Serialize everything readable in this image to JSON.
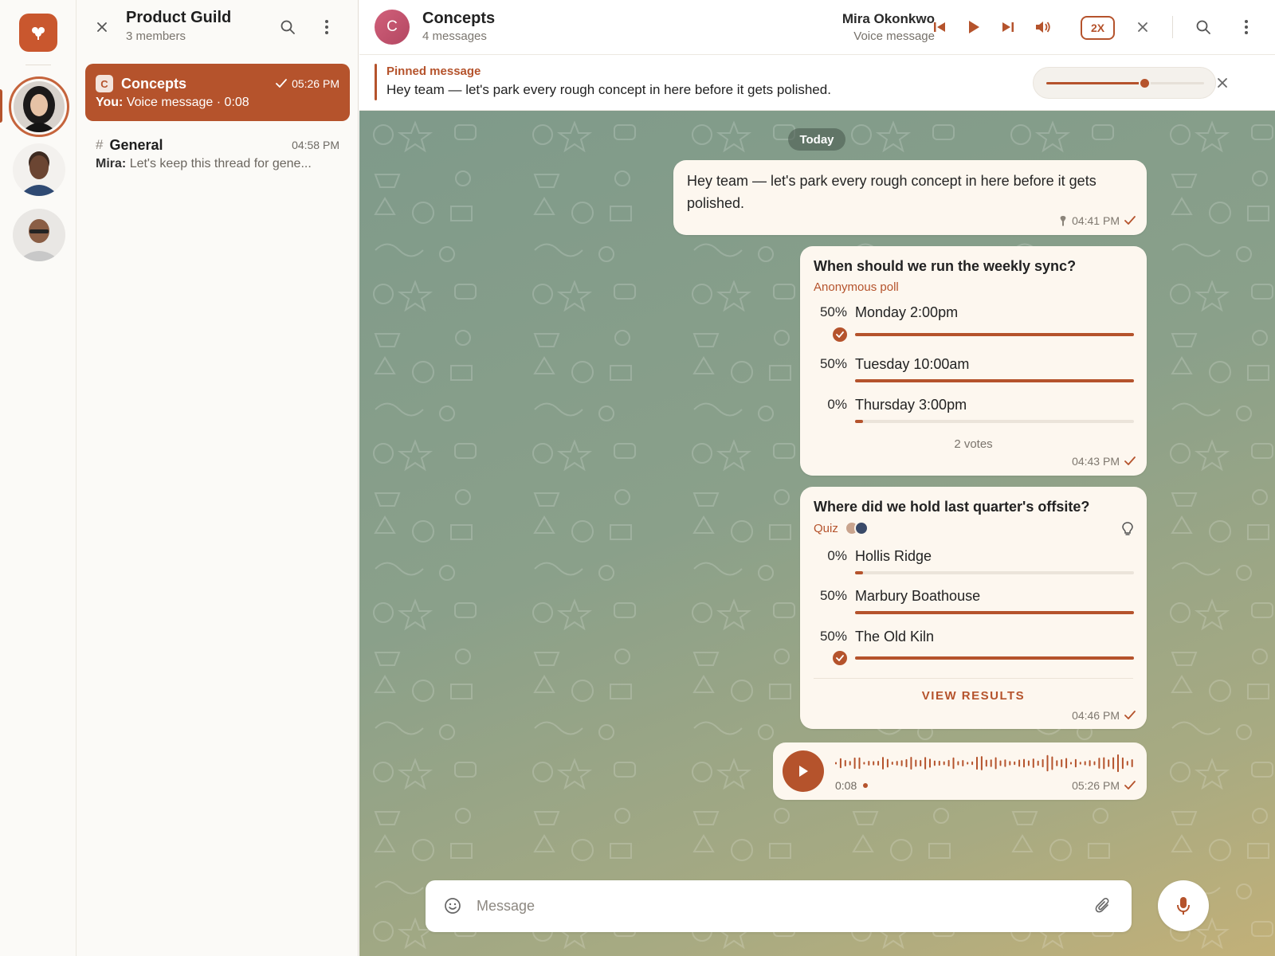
{
  "rail": {
    "avatars": [
      {
        "name": "avatar-user-1",
        "active": true
      },
      {
        "name": "avatar-user-2",
        "active": false
      },
      {
        "name": "avatar-user-3",
        "active": false
      }
    ]
  },
  "chatlist": {
    "title": "Product Guild",
    "subtitle": "3 members",
    "items": [
      {
        "badge": "C",
        "name": "Concepts",
        "time": "05:26 PM",
        "sender": "You:",
        "preview": "Voice message · 0:08"
      },
      {
        "hash": "#",
        "name": "General",
        "time": "04:58 PM",
        "sender": "Mira:",
        "preview": "Let's keep this thread for gene..."
      }
    ]
  },
  "header": {
    "avatar_letter": "C",
    "title": "Concepts",
    "subtitle": "4 messages",
    "player_name": "Mira Okonkwo",
    "player_sub": "Voice message",
    "speed": "2X"
  },
  "pinned": {
    "title": "Pinned message",
    "text": "Hey team — let's park every rough concept in here before it gets polished.",
    "volume": 0.62
  },
  "chat": {
    "date": "Today",
    "msg1": {
      "text": "Hey team — let's park every rough concept in here before it gets polished.",
      "time": "04:41 PM"
    },
    "poll1": {
      "question": "When should we run the weekly sync?",
      "type": "Anonymous poll",
      "options": [
        {
          "pct": "50%",
          "label": "Monday 2:00pm",
          "value": 0.5,
          "chosen": true
        },
        {
          "pct": "50%",
          "label": "Tuesday 10:00am",
          "value": 0.5,
          "chosen": false
        },
        {
          "pct": "0%",
          "label": "Thursday 3:00pm",
          "value": 0,
          "chosen": false
        }
      ],
      "votes": "2 votes",
      "time": "04:43 PM"
    },
    "poll2": {
      "question": "Where did we hold last quarter's offsite?",
      "type": "Quiz",
      "options": [
        {
          "pct": "0%",
          "label": "Hollis Ridge",
          "value": 0,
          "chosen": false
        },
        {
          "pct": "50%",
          "label": "Marbury Boathouse",
          "value": 0.5,
          "chosen": false
        },
        {
          "pct": "50%",
          "label": "The Old Kiln",
          "value": 0.5,
          "chosen": true
        }
      ],
      "action": "VIEW RESULTS",
      "time": "04:46 PM"
    },
    "voice": {
      "duration": "0:08",
      "time": "05:26 PM"
    }
  },
  "composer": {
    "placeholder": "Message"
  },
  "colors": {
    "accent": "#b5532c",
    "bubble": "#fdf7ef"
  }
}
